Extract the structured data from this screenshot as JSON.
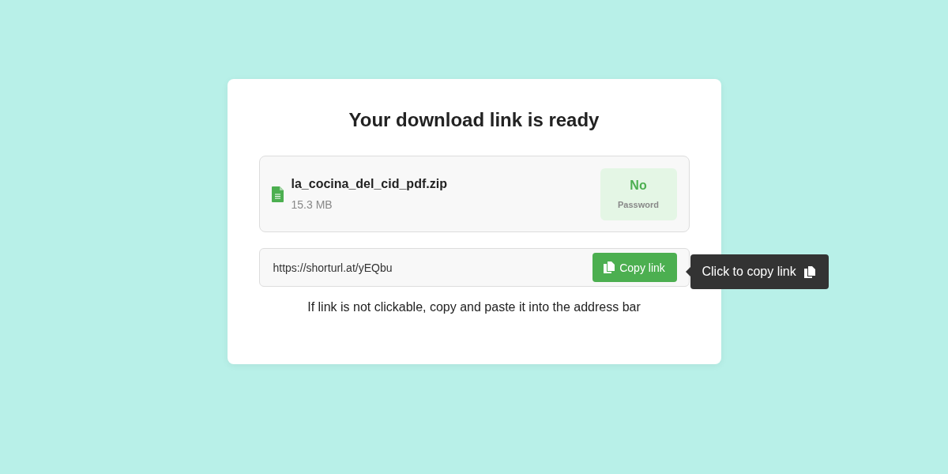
{
  "title": "Your download link is ready",
  "file": {
    "name": "la_cocina_del_cid_pdf.zip",
    "size": "15.3 MB",
    "password_value": "No",
    "password_label": "Password"
  },
  "link": {
    "value": "https://shorturl.at/yEQbu",
    "button": "Copy link"
  },
  "tooltip": {
    "text": "Click to copy link"
  },
  "hint": "If link is not clickable, copy and paste it into the address bar"
}
